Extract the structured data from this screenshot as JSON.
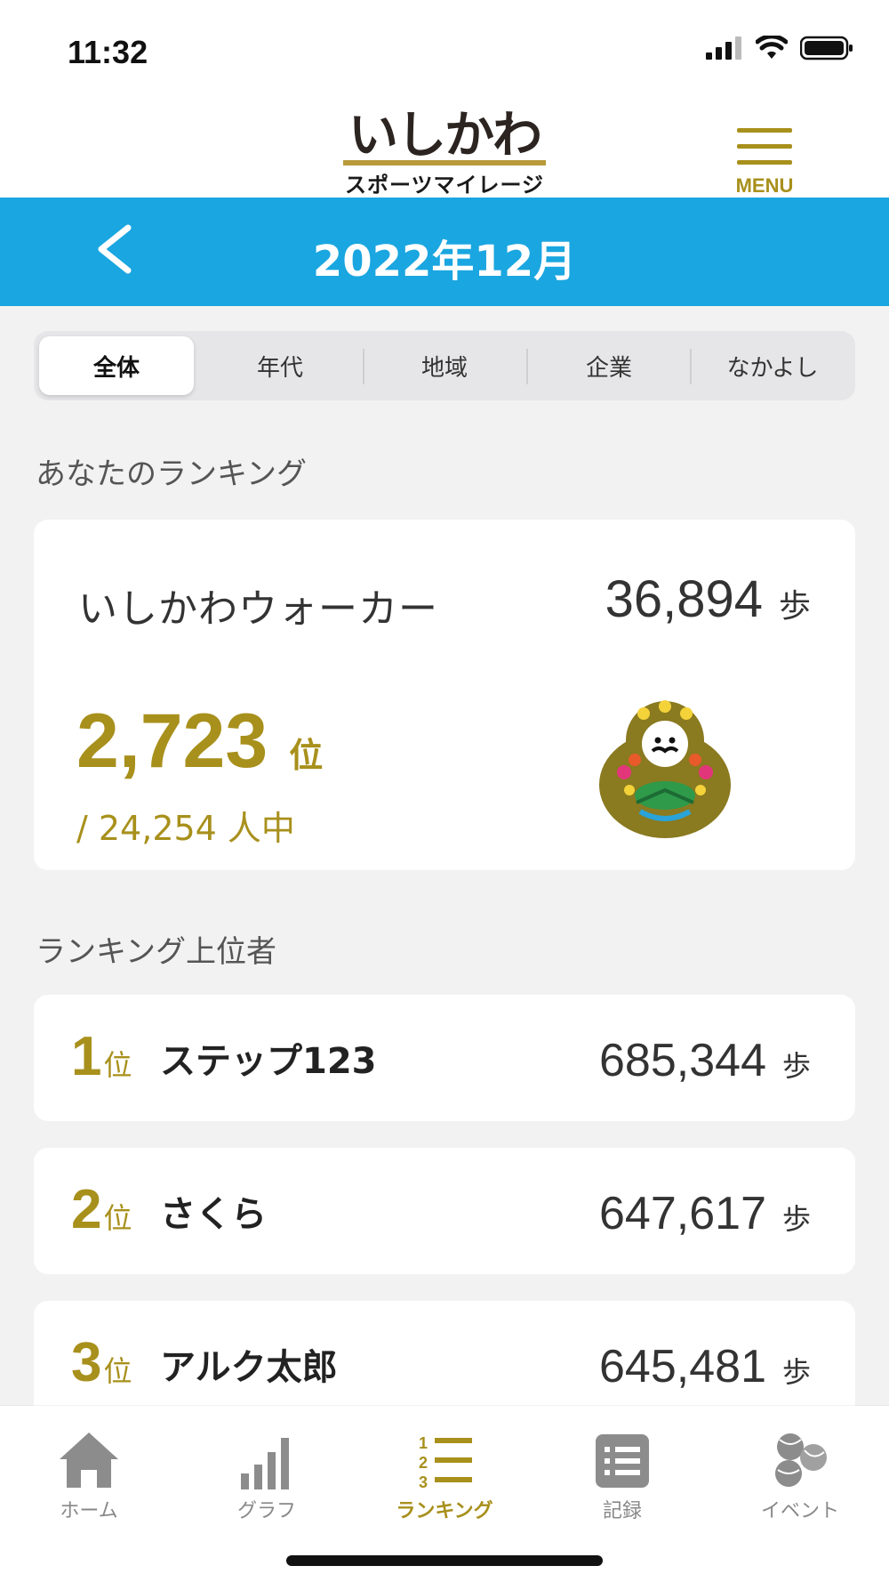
{
  "status": {
    "time": "11:32"
  },
  "header": {
    "logo_main": "いしかわ",
    "logo_sub": "スポーツマイレージ",
    "menu_label": "MENU"
  },
  "month_bar": {
    "back_icon": "chevron-left-icon",
    "title": "2022年12月"
  },
  "segments": [
    {
      "label": "全体",
      "active": true
    },
    {
      "label": "年代",
      "active": false
    },
    {
      "label": "地域",
      "active": false
    },
    {
      "label": "企業",
      "active": false
    },
    {
      "label": "なかよし",
      "active": false
    }
  ],
  "my_section": {
    "heading": "あなたのランキング",
    "name": "いしかわウォーカー",
    "steps": "36,894",
    "steps_unit": "歩",
    "rank": "2,723",
    "rank_unit": "位",
    "total": "/ 24,254 人中"
  },
  "top_section": {
    "heading": "ランキング上位者",
    "rows": [
      {
        "rank": "1",
        "rank_unit": "位",
        "name": "ステップ123",
        "steps": "685,344",
        "steps_unit": "歩"
      },
      {
        "rank": "2",
        "rank_unit": "位",
        "name": "さくら",
        "steps": "647,617",
        "steps_unit": "歩"
      },
      {
        "rank": "3",
        "rank_unit": "位",
        "name": "アルク太郎",
        "steps": "645,481",
        "steps_unit": "歩"
      }
    ]
  },
  "tabbar": [
    {
      "label": "ホーム",
      "icon": "home-icon",
      "active": false
    },
    {
      "label": "グラフ",
      "icon": "bar-graph-icon",
      "active": false
    },
    {
      "label": "ランキング",
      "icon": "ranking-list-icon",
      "active": true
    },
    {
      "label": "記録",
      "icon": "record-list-icon",
      "active": false
    },
    {
      "label": "イベント",
      "icon": "sports-balls-icon",
      "active": false
    }
  ],
  "colors": {
    "accent_gold": "#a8901c",
    "header_blue": "#1aa6e0",
    "background": "#f2f2f2"
  }
}
